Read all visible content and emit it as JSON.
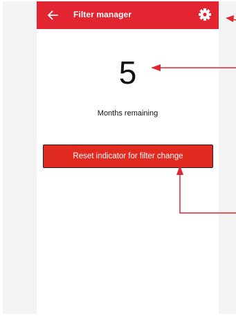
{
  "appbar": {
    "title": "Filter manager",
    "back_icon": "arrow-left-icon",
    "settings_icon": "gear-icon",
    "background": "#e32431"
  },
  "filter": {
    "months_value": "5",
    "months_label": "Months remaining"
  },
  "reset_button": {
    "label": "Reset indicator for filter change",
    "background": "#e12b20"
  },
  "annotation_color": "#e32431"
}
